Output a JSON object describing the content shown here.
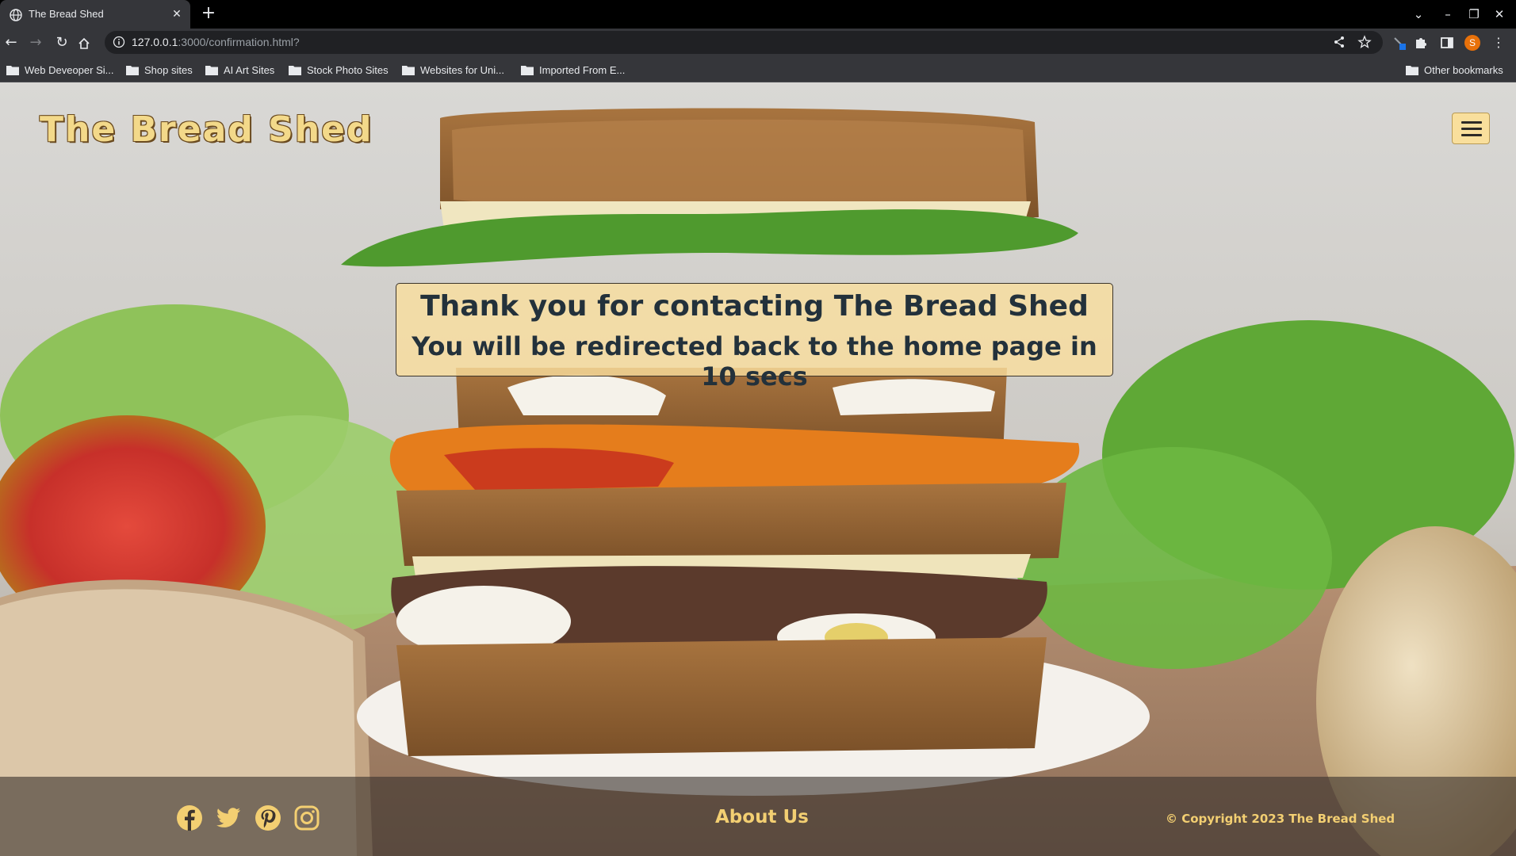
{
  "browser": {
    "tab_title": "The Bread Shed",
    "url_host": "127.0.0.1",
    "url_path": ":3000/confirmation.html?",
    "avatar_letter": "S",
    "bookmarks": [
      {
        "label": "Web Deveoper Si..."
      },
      {
        "label": "Shop sites"
      },
      {
        "label": "AI Art Sites"
      },
      {
        "label": "Stock Photo Sites"
      },
      {
        "label": "Websites for Uni..."
      },
      {
        "label": "Imported From E..."
      }
    ],
    "other_bookmarks": "Other bookmarks"
  },
  "page": {
    "site_title": "The Bread Shed",
    "message_line1": "Thank you for contacting The Bread Shed",
    "message_line2": "You will be redirected back to the home page in 10 secs",
    "footer": {
      "social": [
        "facebook-icon",
        "twitter-icon",
        "pinterest-icon",
        "instagram-icon"
      ],
      "about_link": "About Us",
      "copyright": "© Copyright 2023 The Bread Shed"
    }
  },
  "colors": {
    "title_gold": "#f3d98a",
    "footer_gold": "#f3cf72",
    "message_bg": "#fade9e",
    "message_text": "#23313b",
    "chrome_dark": "#35363a"
  }
}
